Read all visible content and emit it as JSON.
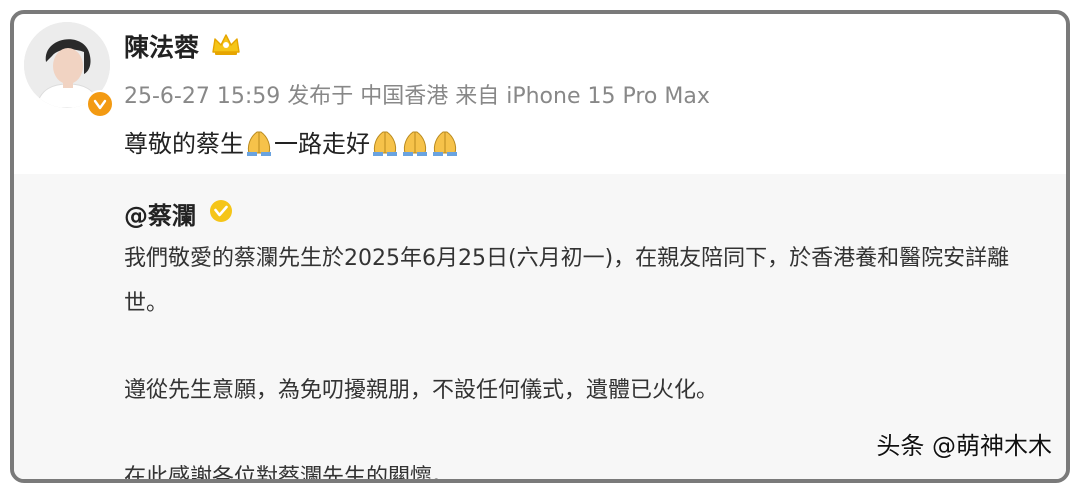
{
  "post": {
    "author_name": "陳法蓉",
    "meta_text": "25-6-27 15:59 发布于 中国香港 来自 iPhone 15 Pro Max",
    "text_part1": "尊敬的蔡生",
    "text_part2": "一路走好",
    "icons": [
      "avatar",
      "verified-badge-icon",
      "crown-badge-icon",
      "praying-hands-icon"
    ]
  },
  "repost": {
    "author_name": "@蔡瀾",
    "paragraphs": [
      "我們敬愛的蔡瀾先生於2025年6月25日(六月初一)，在親友陪同下，於香港養和醫院安詳離世。",
      "遵從先生意願，為免叨擾親朋，不設任何儀式，遺體已火化。",
      "在此感謝各位對蔡瀾先生的關懷。"
    ]
  },
  "watermark": "头条 @萌神木木",
  "colors": {
    "border": "#7a7a7a",
    "repost_bg": "#f7f7f7",
    "meta_gray": "#888888",
    "verified_orange": "#f39a12",
    "badge_gold": "#f5c518"
  }
}
